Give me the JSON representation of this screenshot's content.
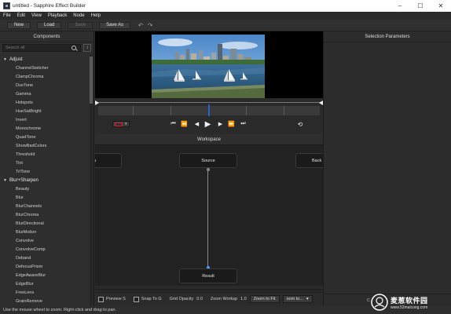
{
  "window": {
    "title": "untitled - Sapphire Effect Builder",
    "minimize_glyph": "–",
    "maximize_glyph": "☐",
    "close_glyph": "✕"
  },
  "menu": [
    "File",
    "Edit",
    "View",
    "Playback",
    "Node",
    "Help"
  ],
  "toolbar": {
    "new_label": "New",
    "load_label": "Load",
    "save_label": "Save",
    "save_as_label": "Save As",
    "undo_icon": "undo-icon",
    "redo_icon": "redo-icon"
  },
  "components": {
    "title": "Components",
    "search_placeholder": "Search all",
    "sort_icon": "sort-az-icon",
    "tree": [
      {
        "label": "Adjust",
        "expanded": true,
        "items": [
          "ChannelSwitcher",
          "ClampChroma",
          "DuoTone",
          "Gamma",
          "Hotspots",
          "HueSatBright",
          "Invert",
          "Monochrome",
          "QuadTone",
          "ShowBadColors",
          "Threshold",
          "Tint",
          "TriTone"
        ]
      },
      {
        "label": "Blur+Sharpen",
        "expanded": true,
        "items": [
          "Beauty",
          "Blur",
          "BlurChannels",
          "BlurChroma",
          "BlurDirectional",
          "BlurMotion",
          "Convolve",
          "ConvolveComp",
          "Deband",
          "DefocusPrism",
          "EdgeAwareBlur",
          "EdgeBlur",
          "FreeLens",
          "GrainRemove"
        ]
      }
    ]
  },
  "viewer": {
    "transport": [
      "⏮",
      "⏪",
      "◀",
      "▶",
      "▶",
      "⏩",
      "⏭"
    ],
    "loop_icon": "loop-icon",
    "color_menu_glyph": "▾"
  },
  "workspace": {
    "title": "Workspace",
    "nodes": {
      "left_partial": "a",
      "source": "Source",
      "right_partial": "Back",
      "result": "Result"
    }
  },
  "bottom_bar": {
    "preview_label": "Preview S",
    "snap_label": "Snap To G",
    "grid_opacity_label": "Grid Opacity",
    "grid_opacity_value": "0.0",
    "zoom_label": "Zoom Worksp",
    "zoom_value": "1.0",
    "zoom_to_fit_label": "Zoom to Fit",
    "zoom_to_label": "oom to..."
  },
  "selection_parameters": {
    "title": "Selection Parameters",
    "footer": "C"
  },
  "status": {
    "hint": "Use the mouse wheel to zoom.  Right-click and drag to pan."
  },
  "watermark": {
    "text": "麦葱软件园",
    "url": "www.52maicong.com"
  },
  "colors": {
    "background": "#2b2b2b",
    "playhead": "#2f5fd0",
    "workspace": "#222222",
    "connector": "#4a9eff"
  }
}
